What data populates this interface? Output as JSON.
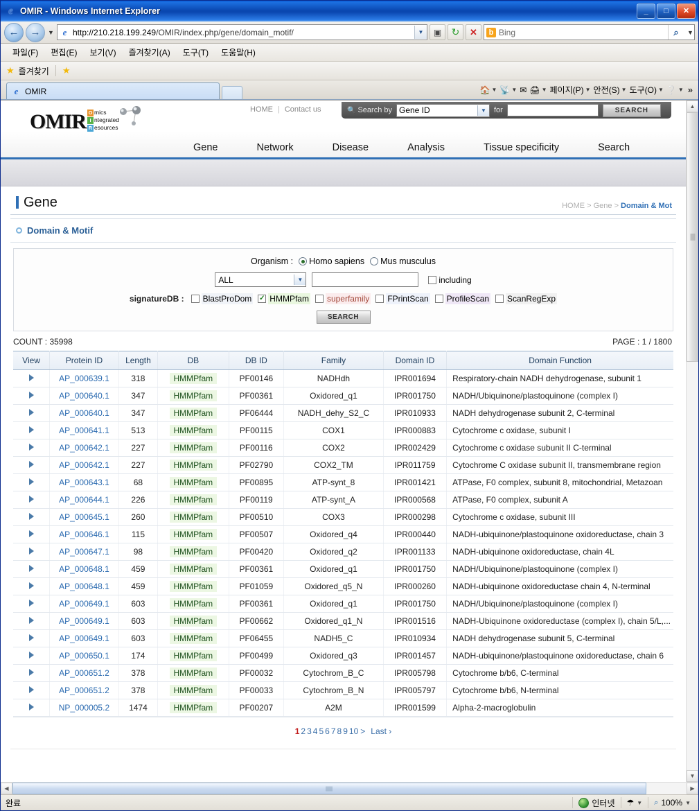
{
  "window": {
    "title": "OMIR - Windows Internet Explorer",
    "minimize": "_",
    "maximize": "□",
    "close": "✕"
  },
  "address": {
    "protocol_host": "http://210.218.199.249",
    "path": "/OMIR/index.php/gene/domain_motif/",
    "search_placeholder": "Bing",
    "bing_mark": "b"
  },
  "menubar": {
    "items": [
      "파일(F)",
      "편집(E)",
      "보기(V)",
      "즐겨찾기(A)",
      "도구(T)",
      "도움말(H)"
    ]
  },
  "favbar": {
    "label": "즐겨찾기"
  },
  "tabs": {
    "active": "OMIR",
    "toolbar_items": [
      "페이지(P)",
      "안전(S)",
      "도구(O)"
    ],
    "overflow": "»"
  },
  "statusbar": {
    "status": "완료",
    "zone": "인터넷",
    "zoom": "100%"
  },
  "site": {
    "logo": {
      "word": "OMIR",
      "rows": [
        {
          "cap": "O",
          "rest": "mics"
        },
        {
          "cap": "I",
          "rest": "ntegrated"
        },
        {
          "cap": "R",
          "rest": "esources"
        }
      ]
    },
    "top_links": {
      "home": "HOME",
      "sep": "|",
      "contact": "Contact us"
    },
    "search_by": {
      "label": "Search by",
      "selected": "Gene ID",
      "for_label": "for",
      "value": "",
      "button": "SEARCH"
    },
    "nav": [
      "Gene",
      "Network",
      "Disease",
      "Analysis",
      "Tissue specificity",
      "Search"
    ],
    "page_title": "Gene",
    "breadcrumb": "HOME > Gene > ",
    "breadcrumb_current": "Domain & Mot",
    "section_title": "Domain & Motif",
    "form": {
      "organism_label": "Organism :",
      "organism_options": [
        "Homo sapiens",
        "Mus musculus"
      ],
      "organism_selected": "Homo sapiens",
      "field_select": "ALL",
      "keyword_value": "",
      "including_label": "including",
      "including_checked": false,
      "signature_label": "signatureDB :",
      "signature_dbs": [
        {
          "name": "BlastProDom",
          "checked": false,
          "bg": "#f0f3f8"
        },
        {
          "name": "HMMPfam",
          "checked": true,
          "bg": "#e9f7df"
        },
        {
          "name": "superfamily",
          "checked": false,
          "bg": "#fbeced",
          "color": "#a34a3c"
        },
        {
          "name": "FPrintScan",
          "checked": false,
          "bg": "#eef2fb"
        },
        {
          "name": "ProfileScan",
          "checked": false,
          "bg": "#efe7f6"
        },
        {
          "name": "ScanRegExp",
          "checked": false,
          "bg": "#f1f1f1"
        }
      ],
      "search_button": "SEARCH"
    },
    "count_label": "COUNT : 35998",
    "page_label": "PAGE : 1 / 1800",
    "table": {
      "columns": [
        "View",
        "Protein ID",
        "Length",
        "DB",
        "DB ID",
        "Family",
        "Domain ID",
        "Domain Function"
      ],
      "rows": [
        {
          "view": "▶",
          "protein_id": "AP_000639.1",
          "length": "318",
          "db": "HMMPfam",
          "db_id": "PF00146",
          "family": "NADHdh",
          "domain_id": "IPR001694",
          "function": "Respiratory-chain NADH dehydrogenase, subunit 1"
        },
        {
          "view": "▶",
          "protein_id": "AP_000640.1",
          "length": "347",
          "db": "HMMPfam",
          "db_id": "PF00361",
          "family": "Oxidored_q1",
          "domain_id": "IPR001750",
          "function": "NADH/Ubiquinone/plastoquinone (complex I)"
        },
        {
          "view": "▶",
          "protein_id": "AP_000640.1",
          "length": "347",
          "db": "HMMPfam",
          "db_id": "PF06444",
          "family": "NADH_dehy_S2_C",
          "domain_id": "IPR010933",
          "function": "NADH dehydrogenase subunit 2, C-terminal"
        },
        {
          "view": "▶",
          "protein_id": "AP_000641.1",
          "length": "513",
          "db": "HMMPfam",
          "db_id": "PF00115",
          "family": "COX1",
          "domain_id": "IPR000883",
          "function": "Cytochrome c oxidase, subunit I"
        },
        {
          "view": "▶",
          "protein_id": "AP_000642.1",
          "length": "227",
          "db": "HMMPfam",
          "db_id": "PF00116",
          "family": "COX2",
          "domain_id": "IPR002429",
          "function": "Cytochrome c oxidase subunit II C-terminal"
        },
        {
          "view": "▶",
          "protein_id": "AP_000642.1",
          "length": "227",
          "db": "HMMPfam",
          "db_id": "PF02790",
          "family": "COX2_TM",
          "domain_id": "IPR011759",
          "function": "Cytochrome C oxidase subunit II, transmembrane region"
        },
        {
          "view": "▶",
          "protein_id": "AP_000643.1",
          "length": "68",
          "db": "HMMPfam",
          "db_id": "PF00895",
          "family": "ATP-synt_8",
          "domain_id": "IPR001421",
          "function": "ATPase, F0 complex, subunit 8, mitochondrial, Metazoan"
        },
        {
          "view": "▶",
          "protein_id": "AP_000644.1",
          "length": "226",
          "db": "HMMPfam",
          "db_id": "PF00119",
          "family": "ATP-synt_A",
          "domain_id": "IPR000568",
          "function": "ATPase, F0 complex, subunit A"
        },
        {
          "view": "▶",
          "protein_id": "AP_000645.1",
          "length": "260",
          "db": "HMMPfam",
          "db_id": "PF00510",
          "family": "COX3",
          "domain_id": "IPR000298",
          "function": "Cytochrome c oxidase, subunit III"
        },
        {
          "view": "▶",
          "protein_id": "AP_000646.1",
          "length": "115",
          "db": "HMMPfam",
          "db_id": "PF00507",
          "family": "Oxidored_q4",
          "domain_id": "IPR000440",
          "function": "NADH-ubiquinone/plastoquinone oxidoreductase, chain 3"
        },
        {
          "view": "▶",
          "protein_id": "AP_000647.1",
          "length": "98",
          "db": "HMMPfam",
          "db_id": "PF00420",
          "family": "Oxidored_q2",
          "domain_id": "IPR001133",
          "function": "NADH-ubiquinone oxidoreductase, chain 4L"
        },
        {
          "view": "▶",
          "protein_id": "AP_000648.1",
          "length": "459",
          "db": "HMMPfam",
          "db_id": "PF00361",
          "family": "Oxidored_q1",
          "domain_id": "IPR001750",
          "function": "NADH/Ubiquinone/plastoquinone (complex I)"
        },
        {
          "view": "▶",
          "protein_id": "AP_000648.1",
          "length": "459",
          "db": "HMMPfam",
          "db_id": "PF01059",
          "family": "Oxidored_q5_N",
          "domain_id": "IPR000260",
          "function": "NADH-ubiquinone oxidoreductase chain 4, N-terminal"
        },
        {
          "view": "▶",
          "protein_id": "AP_000649.1",
          "length": "603",
          "db": "HMMPfam",
          "db_id": "PF00361",
          "family": "Oxidored_q1",
          "domain_id": "IPR001750",
          "function": "NADH/Ubiquinone/plastoquinone (complex I)"
        },
        {
          "view": "▶",
          "protein_id": "AP_000649.1",
          "length": "603",
          "db": "HMMPfam",
          "db_id": "PF00662",
          "family": "Oxidored_q1_N",
          "domain_id": "IPR001516",
          "function": "NADH-Ubiquinone oxidoreductase (complex I), chain 5/L,..."
        },
        {
          "view": "▶",
          "protein_id": "AP_000649.1",
          "length": "603",
          "db": "HMMPfam",
          "db_id": "PF06455",
          "family": "NADH5_C",
          "domain_id": "IPR010934",
          "function": "NADH dehydrogenase subunit 5, C-terminal"
        },
        {
          "view": "▶",
          "protein_id": "AP_000650.1",
          "length": "174",
          "db": "HMMPfam",
          "db_id": "PF00499",
          "family": "Oxidored_q3",
          "domain_id": "IPR001457",
          "function": "NADH-ubiquinone/plastoquinone oxidoreductase, chain 6"
        },
        {
          "view": "▶",
          "protein_id": "AP_000651.2",
          "length": "378",
          "db": "HMMPfam",
          "db_id": "PF00032",
          "family": "Cytochrom_B_C",
          "domain_id": "IPR005798",
          "function": "Cytochrome b/b6, C-terminal"
        },
        {
          "view": "▶",
          "protein_id": "AP_000651.2",
          "length": "378",
          "db": "HMMPfam",
          "db_id": "PF00033",
          "family": "Cytochrom_B_N",
          "domain_id": "IPR005797",
          "function": "Cytochrome b/b6, N-terminal"
        },
        {
          "view": "▶",
          "protein_id": "NP_000005.2",
          "length": "1474",
          "db": "HMMPfam",
          "db_id": "PF00207",
          "family": "A2M",
          "domain_id": "IPR001599",
          "function": "Alpha-2-macroglobulin"
        }
      ]
    },
    "pager": {
      "pages": [
        "1",
        "2",
        "3",
        "4",
        "5",
        "6",
        "7",
        "8",
        "9",
        "10"
      ],
      "current": "1",
      "next": ">",
      "last": "Last ›"
    }
  },
  "colors": {
    "accent_blue": "#2f6fb5",
    "link_blue": "#2a6ab0",
    "active_page_red": "#c11b1b",
    "db_tag_bg": "#ecf7e3",
    "titlebar_blue": "#0a47b0"
  }
}
